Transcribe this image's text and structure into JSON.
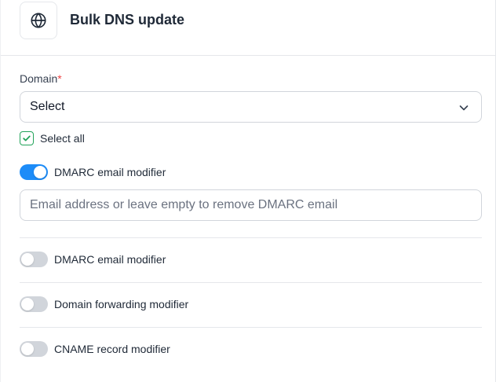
{
  "header": {
    "title": "Bulk DNS update",
    "icon": "globe-icon"
  },
  "domain": {
    "label": "Domain",
    "required_mark": "*",
    "selected_value": "Select"
  },
  "select_all": {
    "label": "Select all",
    "checked": true
  },
  "dmarc_primary": {
    "label": "DMARC email modifier",
    "enabled": true,
    "email_placeholder": "Email address or leave empty to remove DMARC email"
  },
  "modifiers": [
    {
      "label": "DMARC email modifier",
      "enabled": false
    },
    {
      "label": "Domain forwarding modifier",
      "enabled": false
    },
    {
      "label": "CNAME record modifier",
      "enabled": false
    }
  ],
  "colors": {
    "accent": "#1d8cf8",
    "check": "#22a35a",
    "required": "#ef4444"
  }
}
